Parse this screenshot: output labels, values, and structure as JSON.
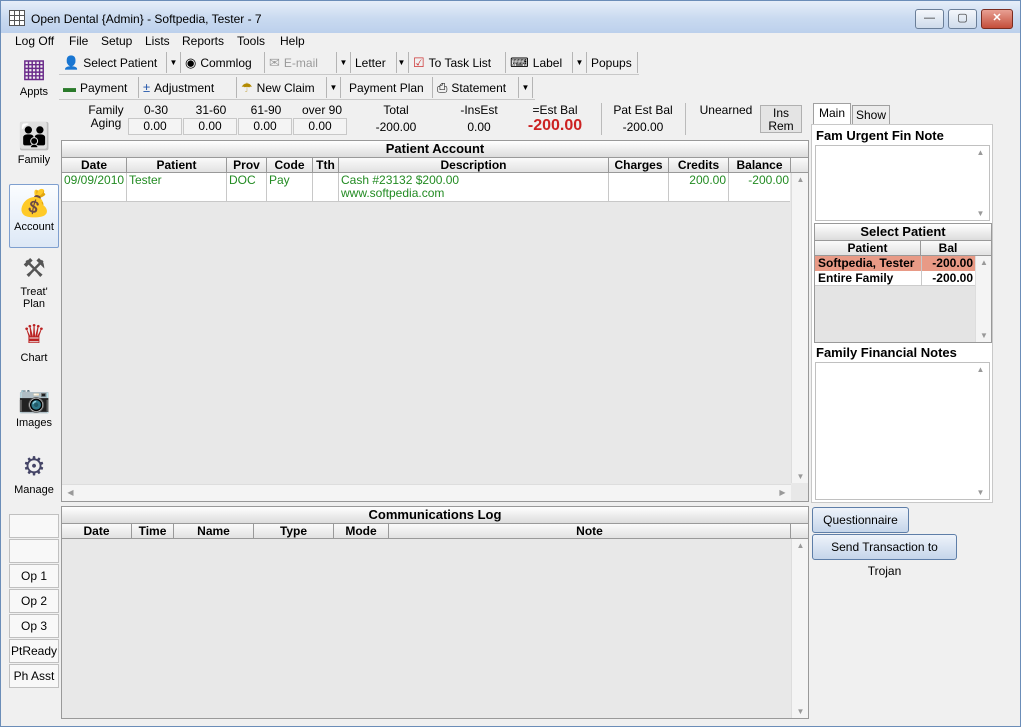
{
  "window": {
    "title": "Open Dental {Admin} - Softpedia, Tester - 7",
    "min": "—",
    "max": "▢",
    "close": "✕"
  },
  "menu": [
    "Log Off",
    "File",
    "Setup",
    "Lists",
    "Reports",
    "Tools",
    "Help"
  ],
  "toolbar1": {
    "select_patient": "Select Patient",
    "commlog": "Commlog",
    "email": "E-mail",
    "letter": "Letter",
    "to_task_list": "To Task List",
    "label": "Label",
    "popups": "Popups"
  },
  "toolbar2": {
    "payment": "Payment",
    "adjustment": "Adjustment",
    "new_claim": "New Claim",
    "payment_plan": "Payment Plan",
    "statement": "Statement"
  },
  "modules": [
    "Appts",
    "Family",
    "Account",
    "Treat' Plan",
    "Chart",
    "Images",
    "Manage"
  ],
  "ops": [
    "",
    "",
    "Op 1",
    "Op 2",
    "Op 3",
    "PtReady",
    "Ph Asst"
  ],
  "aging": {
    "family_label": "Family",
    "aging_label": "Aging",
    "headers": [
      "0-30",
      "31-60",
      "61-90",
      "over 90",
      "Total",
      "-InsEst",
      "=Est Bal",
      "Pat Est Bal",
      "Unearned"
    ],
    "values": [
      "0.00",
      "0.00",
      "0.00",
      "0.00",
      "-200.00",
      "0.00",
      "-200.00",
      "-200.00",
      ""
    ],
    "ins_rem": "Ins Rem"
  },
  "patient_account": {
    "title": "Patient Account",
    "columns": [
      "Date",
      "Patient",
      "Prov",
      "Code",
      "Tth",
      "Description",
      "Charges",
      "Credits",
      "Balance"
    ],
    "rows": [
      {
        "date": "09/09/2010",
        "patient": "Tester",
        "prov": "DOC",
        "code": "Pay",
        "tth": "",
        "desc1": "Cash #23132 $200.00",
        "desc2": "www.softpedia.com",
        "charges": "",
        "credits": "200.00",
        "balance": "-200.00"
      }
    ]
  },
  "comm_log": {
    "title": "Communications Log",
    "columns": [
      "Date",
      "Time",
      "Name",
      "Type",
      "Mode",
      "Note"
    ]
  },
  "right_panel": {
    "tabs": [
      "Main",
      "Show"
    ],
    "urgent_title": "Fam Urgent Fin Note",
    "select_patient_title": "Select Patient",
    "sp_columns": [
      "Patient",
      "Bal"
    ],
    "sp_rows": [
      {
        "patient": "Softpedia, Tester",
        "bal": "-200.00"
      },
      {
        "patient": "Entire Family",
        "bal": "-200.00"
      }
    ],
    "fin_notes_title": "Family Financial Notes"
  },
  "buttons": {
    "questionnaire": "Questionnaire",
    "send_trojan": "Send Transaction to Trojan"
  },
  "colors": {
    "est_bal_red": "#cc2222",
    "selected_row": "#e89a86",
    "green_text": "#228b22"
  }
}
